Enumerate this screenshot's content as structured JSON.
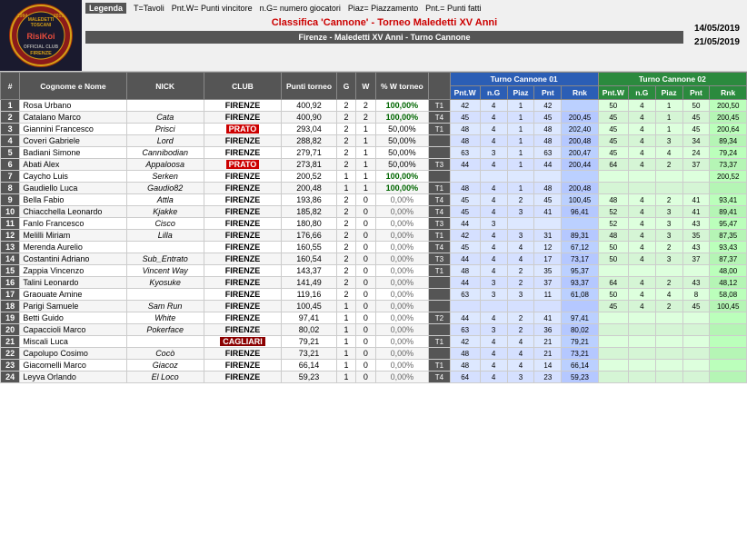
{
  "header": {
    "logo_text": "MALEDETTI TOSCANI\nRisiKoi\nOFFICIAL CLUB\nFIRENZE",
    "legend_label": "Legenda",
    "legend_items": [
      {
        "key": "T=Tavoli"
      },
      {
        "key": "Pnt.W= Punti vincitore"
      },
      {
        "key": "n.G= numero giocatori"
      },
      {
        "key": "Piaz= Piazzamento"
      },
      {
        "key": "Pnt.= Punti fatti"
      }
    ],
    "title": "Classifica 'Cannone' - Torneo Maledetti XV Anni",
    "dates": [
      {
        "label": "14/05/2019"
      },
      {
        "label": "21/05/2019"
      }
    ],
    "subtitle": "Firenze - Maledetti XV Anni - Turno Cannone"
  },
  "columns": {
    "rank": "#",
    "name": "Cognome e Nome",
    "nick": "NICK",
    "club": "CLUB",
    "pts": "Punti torneo",
    "g": "G",
    "w": "W",
    "pct": "% W torneo",
    "tc1_label": "Turno Cannone 01",
    "tc2_label": "Turno Cannone 02",
    "sub_pntw": "Pnt.W",
    "sub_ng": "n.G",
    "sub_piaz": "Piaz",
    "sub_pnt": "Pnt",
    "sub_rnk": "Rnk"
  },
  "rows": [
    {
      "rank": 1,
      "name": "Rosa Urbano",
      "nick": "",
      "club": "FIRENZE",
      "club_class": "club-firenze",
      "pts": "400,92",
      "g": 2,
      "w": 2,
      "pct": "100,00%",
      "pct_class": "pct-100",
      "trn": "T1",
      "tc1_pntw": 42,
      "tc1_ng": 4,
      "tc1_piaz": 1,
      "tc1_pnt": 42,
      "tc1_rnk": "",
      "tc2_pntw": 50,
      "tc2_ng": 4,
      "tc2_piaz": 1,
      "tc2_pnt": 50,
      "tc2_rnk": "200,50"
    },
    {
      "rank": 2,
      "name": "Catalano Marco",
      "nick": "Cata",
      "club": "FIRENZE",
      "club_class": "club-firenze",
      "pts": "400,90",
      "g": 2,
      "w": 2,
      "pct": "100,00%",
      "pct_class": "pct-100",
      "trn": "T4",
      "tc1_pntw": 45,
      "tc1_ng": 4,
      "tc1_piaz": 1,
      "tc1_pnt": 45,
      "tc1_rnk": "200,45",
      "tc2_pntw": 45,
      "tc2_ng": 4,
      "tc2_piaz": 1,
      "tc2_pnt": 45,
      "tc2_rnk": "200,45"
    },
    {
      "rank": 3,
      "name": "Giannini Francesco",
      "nick": "Prisci",
      "club": "PRATO",
      "club_class": "club-prato",
      "pts": "293,04",
      "g": 2,
      "w": 1,
      "pct": "50,00%",
      "pct_class": "pct-50",
      "trn": "T1",
      "tc1_pntw": 48,
      "tc1_ng": 4,
      "tc1_piaz": 1,
      "tc1_pnt": 48,
      "tc1_rnk": "202,40",
      "tc2_pntw": 45,
      "tc2_ng": 4,
      "tc2_piaz": 1,
      "tc2_pnt": 45,
      "tc2_rnk": "200,64"
    },
    {
      "rank": 4,
      "name": "Coveri Gabriele",
      "nick": "Lord",
      "club": "FIRENZE",
      "club_class": "club-firenze",
      "pts": "288,82",
      "g": 2,
      "w": 1,
      "pct": "50,00%",
      "pct_class": "pct-50",
      "trn": "",
      "tc1_pntw": 48,
      "tc1_ng": 4,
      "tc1_piaz": 1,
      "tc1_pnt": 48,
      "tc1_rnk": "200,48",
      "tc2_pntw": 45,
      "tc2_ng": 4,
      "tc2_piaz": 3,
      "tc2_pnt": 34,
      "tc2_rnk": "89,34"
    },
    {
      "rank": 5,
      "name": "Badiani Simone",
      "nick": "Cannibodian",
      "club": "FIRENZE",
      "club_class": "club-firenze",
      "pts": "279,71",
      "g": 2,
      "w": 1,
      "pct": "50,00%",
      "pct_class": "pct-50",
      "trn": "",
      "tc1_pntw": 63,
      "tc1_ng": 3,
      "tc1_piaz": 1,
      "tc1_pnt": 63,
      "tc1_rnk": "200,47",
      "tc2_pntw": 45,
      "tc2_ng": 4,
      "tc2_piaz": 4,
      "tc2_pnt": 24,
      "tc2_rnk": "79,24"
    },
    {
      "rank": 6,
      "name": "Abati Alex",
      "nick": "Appaloosa",
      "club": "PRATO",
      "club_class": "club-prato",
      "pts": "273,81",
      "g": 2,
      "w": 1,
      "pct": "50,00%",
      "pct_class": "pct-50",
      "trn": "T3",
      "tc1_pntw": 44,
      "tc1_ng": 4,
      "tc1_piaz": 1,
      "tc1_pnt": 44,
      "tc1_rnk": "200,44",
      "tc2_pntw": 64,
      "tc2_ng": 4,
      "tc2_piaz": 2,
      "tc2_pnt": 37,
      "tc2_rnk": "73,37"
    },
    {
      "rank": 7,
      "name": "Caycho Luis",
      "nick": "Serken",
      "club": "FIRENZE",
      "club_class": "club-firenze",
      "pts": "200,52",
      "g": 1,
      "w": 1,
      "pct": "100,00%",
      "pct_class": "pct-100",
      "trn": "",
      "tc1_pntw": "",
      "tc1_ng": "",
      "tc1_piaz": "",
      "tc1_pnt": "",
      "tc1_rnk": "",
      "tc2_pntw": "",
      "tc2_ng": "",
      "tc2_piaz": "",
      "tc2_pnt": "",
      "tc2_rnk": "200,52"
    },
    {
      "rank": 8,
      "name": "Gaudiello Luca",
      "nick": "Gaudio82",
      "club": "FIRENZE",
      "club_class": "club-firenze",
      "pts": "200,48",
      "g": 1,
      "w": 1,
      "pct": "100,00%",
      "pct_class": "pct-100",
      "trn": "T1",
      "tc1_pntw": 48,
      "tc1_ng": 4,
      "tc1_piaz": 1,
      "tc1_pnt": 48,
      "tc1_rnk": "200,48",
      "tc2_pntw": "",
      "tc2_ng": "",
      "tc2_piaz": "",
      "tc2_pnt": "",
      "tc2_rnk": ""
    },
    {
      "rank": 9,
      "name": "Bella Fabio",
      "nick": "Attla",
      "club": "FIRENZE",
      "club_class": "club-firenze",
      "pts": "193,86",
      "g": 2,
      "w": 0,
      "pct": "0,00%",
      "pct_class": "pct-0",
      "trn": "T4",
      "tc1_pntw": 45,
      "tc1_ng": 4,
      "tc1_piaz": 2,
      "tc1_pnt": 45,
      "tc1_rnk": "100,45",
      "tc2_pntw": 48,
      "tc2_ng": 4,
      "tc2_piaz": 2,
      "tc2_pnt": 41,
      "tc2_rnk": "93,41"
    },
    {
      "rank": 10,
      "name": "Chiacchella Leonardo",
      "nick": "Kjakke",
      "club": "FIRENZE",
      "club_class": "club-firenze",
      "pts": "185,82",
      "g": 2,
      "w": 0,
      "pct": "0,00%",
      "pct_class": "pct-0",
      "trn": "T4",
      "tc1_pntw": 45,
      "tc1_ng": 4,
      "tc1_piaz": 3,
      "tc1_pnt": 41,
      "tc1_rnk": "96,41",
      "tc2_pntw": 52,
      "tc2_ng": 4,
      "tc2_piaz": 3,
      "tc2_pnt": 41,
      "tc2_rnk": "89,41"
    },
    {
      "rank": 11,
      "name": "Fanlo Francesco",
      "nick": "Cisco",
      "club": "FIRENZE",
      "club_class": "club-firenze",
      "pts": "180,80",
      "g": 2,
      "w": 0,
      "pct": "0,00%",
      "pct_class": "pct-0",
      "trn": "T3",
      "tc1_pntw": 44,
      "tc1_ng": 3,
      "tc1_piaz": "",
      "tc1_pnt": "",
      "tc1_rnk": "",
      "tc2_pntw": 52,
      "tc2_ng": 4,
      "tc2_piaz": 3,
      "tc2_pnt": 43,
      "tc2_rnk": "95,47"
    },
    {
      "rank": 12,
      "name": "Melilli Miriam",
      "nick": "Lilla",
      "club": "FIRENZE",
      "club_class": "club-firenze",
      "pts": "176,66",
      "g": 2,
      "w": 0,
      "pct": "0,00%",
      "pct_class": "pct-0",
      "trn": "T1",
      "tc1_pntw": 42,
      "tc1_ng": 4,
      "tc1_piaz": 3,
      "tc1_pnt": 31,
      "tc1_rnk": "89,31",
      "tc2_pntw": 48,
      "tc2_ng": 4,
      "tc2_piaz": 3,
      "tc2_pnt": 35,
      "tc2_rnk": "87,35"
    },
    {
      "rank": 13,
      "name": "Merenda Aurelio",
      "nick": "",
      "club": "FIRENZE",
      "club_class": "club-firenze",
      "pts": "160,55",
      "g": 2,
      "w": 0,
      "pct": "0,00%",
      "pct_class": "pct-0",
      "trn": "T4",
      "tc1_pntw": 45,
      "tc1_ng": 4,
      "tc1_piaz": 4,
      "tc1_pnt": 12,
      "tc1_rnk": "67,12",
      "tc2_pntw": 50,
      "tc2_ng": 4,
      "tc2_piaz": 2,
      "tc2_pnt": 43,
      "tc2_rnk": "93,43"
    },
    {
      "rank": 14,
      "name": "Costantini Adriano",
      "nick": "Sub_Entrato",
      "club": "FIRENZE",
      "club_class": "club-firenze",
      "pts": "160,54",
      "g": 2,
      "w": 0,
      "pct": "0,00%",
      "pct_class": "pct-0",
      "trn": "T3",
      "tc1_pntw": 44,
      "tc1_ng": 4,
      "tc1_piaz": 4,
      "tc1_pnt": 17,
      "tc1_rnk": "73,17",
      "tc2_pntw": 50,
      "tc2_ng": 4,
      "tc2_piaz": 3,
      "tc2_pnt": 37,
      "tc2_rnk": "87,37"
    },
    {
      "rank": 15,
      "name": "Zappia Vincenzo",
      "nick": "Vincent Way",
      "club": "FIRENZE",
      "club_class": "club-firenze",
      "pts": "143,37",
      "g": 2,
      "w": 0,
      "pct": "0,00%",
      "pct_class": "pct-0",
      "trn": "T1",
      "tc1_pntw": 48,
      "tc1_ng": 4,
      "tc1_piaz": 2,
      "tc1_pnt": 35,
      "tc1_rnk": "95,37",
      "tc2_pntw": "",
      "tc2_ng": "",
      "tc2_piaz": "",
      "tc2_pnt": "",
      "tc2_rnk": "48,00"
    },
    {
      "rank": 16,
      "name": "Talini Leonardo",
      "nick": "Kyosuke",
      "club": "FIRENZE",
      "club_class": "club-firenze",
      "pts": "141,49",
      "g": 2,
      "w": 0,
      "pct": "0,00%",
      "pct_class": "pct-0",
      "trn": "",
      "tc1_pntw": 44,
      "tc1_ng": 3,
      "tc1_piaz": 2,
      "tc1_pnt": 37,
      "tc1_rnk": "93,37",
      "tc2_pntw": 64,
      "tc2_ng": 4,
      "tc2_piaz": 2,
      "tc2_pnt": 43,
      "tc2_rnk": "48,12"
    },
    {
      "rank": 17,
      "name": "Graouate Amine",
      "nick": "",
      "club": "FIRENZE",
      "club_class": "club-firenze",
      "pts": "119,16",
      "g": 2,
      "w": 0,
      "pct": "0,00%",
      "pct_class": "pct-0",
      "trn": "",
      "tc1_pntw": 63,
      "tc1_ng": 3,
      "tc1_piaz": 3,
      "tc1_pnt": 11,
      "tc1_rnk": "61,08",
      "tc2_pntw": 50,
      "tc2_ng": 4,
      "tc2_piaz": 4,
      "tc2_pnt": 8,
      "tc2_rnk": "58,08"
    },
    {
      "rank": 18,
      "name": "Parigi Samuele",
      "nick": "Sam Run",
      "club": "FIRENZE",
      "club_class": "club-firenze",
      "pts": "100,45",
      "g": 1,
      "w": 0,
      "pct": "0,00%",
      "pct_class": "pct-0",
      "trn": "",
      "tc1_pntw": "",
      "tc1_ng": "",
      "tc1_piaz": "",
      "tc1_pnt": "",
      "tc1_rnk": "",
      "tc2_pntw": 45,
      "tc2_ng": 4,
      "tc2_piaz": 2,
      "tc2_pnt": 45,
      "tc2_rnk": "100,45"
    },
    {
      "rank": 19,
      "name": "Betti Guido",
      "nick": "White",
      "club": "FIRENZE",
      "club_class": "club-firenze",
      "pts": "97,41",
      "g": 1,
      "w": 0,
      "pct": "0,00%",
      "pct_class": "pct-0",
      "trn": "T2",
      "tc1_pntw": 44,
      "tc1_ng": 4,
      "tc1_piaz": 2,
      "tc1_pnt": 41,
      "tc1_rnk": "97,41",
      "tc2_pntw": "",
      "tc2_ng": "",
      "tc2_piaz": "",
      "tc2_pnt": "",
      "tc2_rnk": ""
    },
    {
      "rank": 20,
      "name": "Capaccioli Marco",
      "nick": "Pokerface",
      "club": "FIRENZE",
      "club_class": "club-firenze",
      "pts": "80,02",
      "g": 1,
      "w": 0,
      "pct": "0,00%",
      "pct_class": "pct-0",
      "trn": "",
      "tc1_pntw": 63,
      "tc1_ng": 3,
      "tc1_piaz": 2,
      "tc1_pnt": 36,
      "tc1_rnk": "80,02",
      "tc2_pntw": "",
      "tc2_ng": "",
      "tc2_piaz": "",
      "tc2_pnt": "",
      "tc2_rnk": ""
    },
    {
      "rank": 21,
      "name": "Miscali Luca",
      "nick": "",
      "club": "CAGLIARI",
      "club_class": "club-cagliari",
      "pts": "79,21",
      "g": 1,
      "w": 0,
      "pct": "0,00%",
      "pct_class": "pct-0",
      "trn": "T1",
      "tc1_pntw": 42,
      "tc1_ng": 4,
      "tc1_piaz": 4,
      "tc1_pnt": 21,
      "tc1_rnk": "79,21",
      "tc2_pntw": "",
      "tc2_ng": "",
      "tc2_piaz": "",
      "tc2_pnt": "",
      "tc2_rnk": ""
    },
    {
      "rank": 22,
      "name": "Capolupo Cosimo",
      "nick": "Cocò",
      "club": "FIRENZE",
      "club_class": "club-firenze",
      "pts": "73,21",
      "g": 1,
      "w": 0,
      "pct": "0,00%",
      "pct_class": "pct-0",
      "trn": "",
      "tc1_pntw": 48,
      "tc1_ng": 4,
      "tc1_piaz": 4,
      "tc1_pnt": 21,
      "tc1_rnk": "73,21",
      "tc2_pntw": "",
      "tc2_ng": "",
      "tc2_piaz": "",
      "tc2_pnt": "",
      "tc2_rnk": ""
    },
    {
      "rank": 23,
      "name": "Giacomelli Marco",
      "nick": "Giacoz",
      "club": "FIRENZE",
      "club_class": "club-firenze",
      "pts": "66,14",
      "g": 1,
      "w": 0,
      "pct": "0,00%",
      "pct_class": "pct-0",
      "trn": "T1",
      "tc1_pntw": 48,
      "tc1_ng": 4,
      "tc1_piaz": 4,
      "tc1_pnt": 14,
      "tc1_rnk": "66,14",
      "tc2_pntw": "",
      "tc2_ng": "",
      "tc2_piaz": "",
      "tc2_pnt": "",
      "tc2_rnk": ""
    },
    {
      "rank": 24,
      "name": "Leyva Orlando",
      "nick": "El Loco",
      "club": "FIRENZE",
      "club_class": "club-firenze",
      "pts": "59,23",
      "g": 1,
      "w": 0,
      "pct": "0,00%",
      "pct_class": "pct-0",
      "trn": "T4",
      "tc1_pntw": 64,
      "tc1_ng": 4,
      "tc1_piaz": 3,
      "tc1_pnt": 23,
      "tc1_rnk": "59,23",
      "tc2_pntw": "",
      "tc2_ng": "",
      "tc2_piaz": "",
      "tc2_pnt": "",
      "tc2_rnk": ""
    }
  ]
}
